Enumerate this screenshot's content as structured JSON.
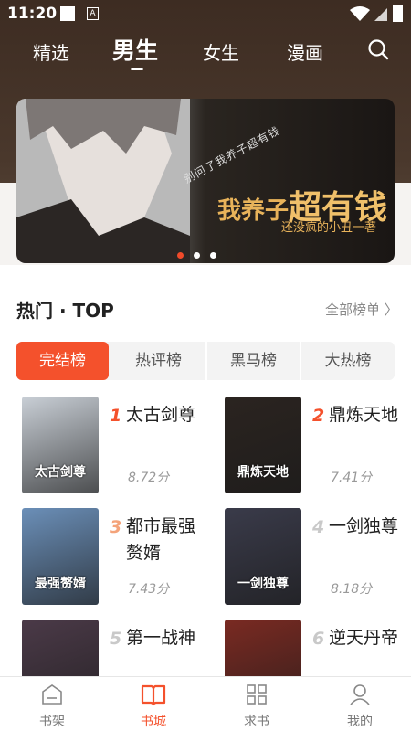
{
  "status": {
    "time": "11:20"
  },
  "nav": {
    "tabs": [
      "精选",
      "男生",
      "女生",
      "漫画"
    ],
    "active": "男生"
  },
  "banner": {
    "subtitle": "别问了我养子超有钱",
    "title_a": "我养子",
    "title_b": "超有钱",
    "author": "还没疯的小丑一著",
    "active_dot": 0
  },
  "section": {
    "title": "热门 · TOP",
    "more": "全部榜单 〉",
    "tabs": [
      "完结榜",
      "热评榜",
      "黑马榜",
      "大热榜"
    ],
    "active_tab": "完结榜"
  },
  "books": [
    {
      "rank": "1",
      "name": "太古剑尊",
      "score": "8.72分",
      "cover_text": "太古剑尊",
      "cover_color": "#c9cfd6",
      "rank_color": "#f4512c"
    },
    {
      "rank": "2",
      "name": "鼎炼天地",
      "score": "7.41分",
      "cover_text": "鼎炼天地",
      "cover_color": "#2b2420",
      "rank_color": "#f4512c"
    },
    {
      "rank": "3",
      "name": "都市最强赘婿",
      "score": "7.43分",
      "cover_text": "最强赘婿",
      "cover_color": "#6b8fb8",
      "rank_color": "#f4a37a"
    },
    {
      "rank": "4",
      "name": "一剑独尊",
      "score": "8.18分",
      "cover_text": "一剑独尊",
      "cover_color": "#3a3b4a",
      "rank_color": "#c9c9c9"
    },
    {
      "rank": "5",
      "name": "第一战神",
      "score": "",
      "cover_text": "",
      "cover_color": "#4b3a48",
      "rank_color": "#c9c9c9"
    },
    {
      "rank": "6",
      "name": "逆天丹帝",
      "score": "",
      "cover_text": "",
      "cover_color": "#7a2a22",
      "rank_color": "#c9c9c9"
    }
  ],
  "bottom_nav": [
    {
      "label": "书架",
      "icon": "bookshelf-icon"
    },
    {
      "label": "书城",
      "icon": "book-open-icon"
    },
    {
      "label": "求书",
      "icon": "grid-icon"
    },
    {
      "label": "我的",
      "icon": "user-icon"
    }
  ],
  "colors": {
    "accent": "#f4512c",
    "header_bg": "#3d2c22"
  }
}
